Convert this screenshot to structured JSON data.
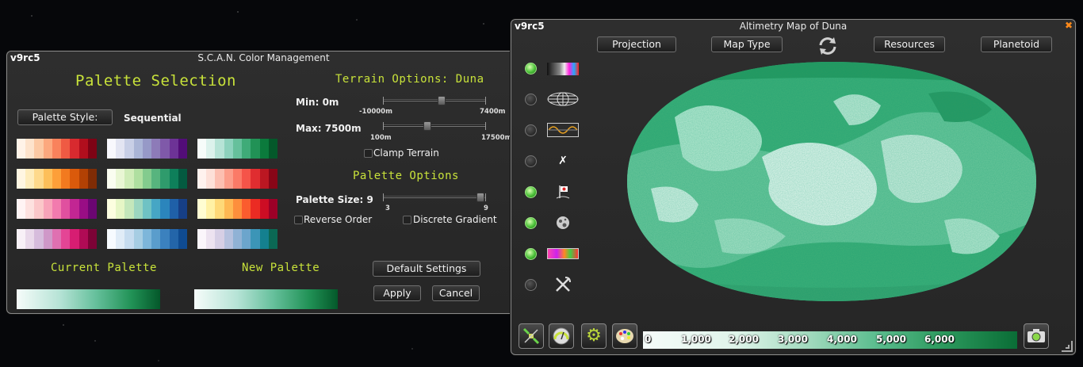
{
  "color_window": {
    "version": "v9rc5",
    "title": "S.C.A.N. Color Management",
    "close": "✖",
    "palette_selection_title": "Palette Selection",
    "palette_style_label": "Palette Style:",
    "palette_style_value": "Sequential",
    "palettes": [
      [
        "#fff3e8",
        "#fde3cc",
        "#fcc9a4",
        "#fca87e",
        "#f9825c",
        "#ef5a43",
        "#d82a2f",
        "#b10e1d",
        "#7e0315"
      ],
      [
        "#f8f8fd",
        "#e3e5f2",
        "#c8cfe6",
        "#aab5d6",
        "#9699c7",
        "#8d7bb8",
        "#7f59a9",
        "#6d3396",
        "#520d78"
      ],
      [
        "#f6fcfa",
        "#dcf2ec",
        "#b6e3d6",
        "#8dd2bd",
        "#66c09c",
        "#3fab78",
        "#219256",
        "#0b7a3c",
        "#04582a"
      ],
      [
        "#fff6e2",
        "#feecbc",
        "#fed98c",
        "#fdbf5a",
        "#fd9f39",
        "#f27a1f",
        "#da5a0b",
        "#b24104",
        "#7f2c05"
      ],
      [
        "#fafdf0",
        "#e9f6d4",
        "#cfecb8",
        "#afdfa0",
        "#83cb8e",
        "#57b47e",
        "#2f9b6c",
        "#0e7f5a",
        "#045a40"
      ],
      [
        "#fff2ee",
        "#fde0d8",
        "#fcbfb1",
        "#fc9d8a",
        "#fb7a67",
        "#f55449",
        "#e02d30",
        "#bb1722",
        "#880617"
      ],
      [
        "#fff4f4",
        "#fde1df",
        "#fbc7c9",
        "#f8a3b9",
        "#f27bae",
        "#e0509f",
        "#c22693",
        "#990d85",
        "#6b0672"
      ],
      [
        "#fcfee0",
        "#e6f6c6",
        "#c4e7bb",
        "#9cd6c0",
        "#6fc2c4",
        "#46a6c5",
        "#2b85bc",
        "#1f60a8",
        "#163f86"
      ],
      [
        "#fffdd2",
        "#fff1a5",
        "#fed978",
        "#feb853",
        "#fd8f3c",
        "#fb5c2e",
        "#eb2b23",
        "#cd0d24",
        "#9c0027"
      ],
      [
        "#f8f1f7",
        "#e9d9ea",
        "#d6bcdc",
        "#cf98c8",
        "#df70b1",
        "#e44595",
        "#d71d72",
        "#b00b55",
        "#7c0336"
      ],
      [
        "#f7fbff",
        "#e0ecf7",
        "#c6dcef",
        "#a6cde3",
        "#7db6da",
        "#5a9dcc",
        "#3b81be",
        "#2365a9",
        "#0f4b91"
      ],
      [
        "#fbf6fb",
        "#ede3f0",
        "#d7cfe5",
        "#b6c1de",
        "#90b2d5",
        "#6ca5cc",
        "#3c95b7",
        "#14808f",
        "#0b6854"
      ]
    ],
    "current_palette_label": "Current Palette",
    "new_palette_label": "New Palette",
    "terrain_title": "Terrain Options: Duna",
    "min_label": "Min: 0m",
    "min_low": "-10000m",
    "min_high": "7400m",
    "max_label": "Max: 7500m",
    "max_low": "100m",
    "max_high": "17500m",
    "min_value": 0.57,
    "max_value": 0.42,
    "clamp_label": "Clamp Terrain",
    "palette_options_title": "Palette Options",
    "palette_size_label": "Palette Size: 9",
    "size_low": "3",
    "size_high": "9",
    "size_value": 1.0,
    "reverse_label": "Reverse Order",
    "discrete_label": "Discrete Gradient",
    "default_btn": "Default Settings",
    "apply_btn": "Apply",
    "cancel_btn": "Cancel"
  },
  "map_window": {
    "version": "v9rc5",
    "title": "Altimetry Map of Duna",
    "close": "✖",
    "projection_btn": "Projection",
    "map_type_btn": "Map Type",
    "resources_btn": "Resources",
    "planetoid_btn": "Planetoid",
    "legend_labels": [
      "0",
      "1,000",
      "2,000",
      "3,000",
      "4,000",
      "5,000",
      "6,000"
    ],
    "toggles": [
      true,
      false,
      false,
      false,
      true,
      true,
      true,
      false
    ]
  }
}
